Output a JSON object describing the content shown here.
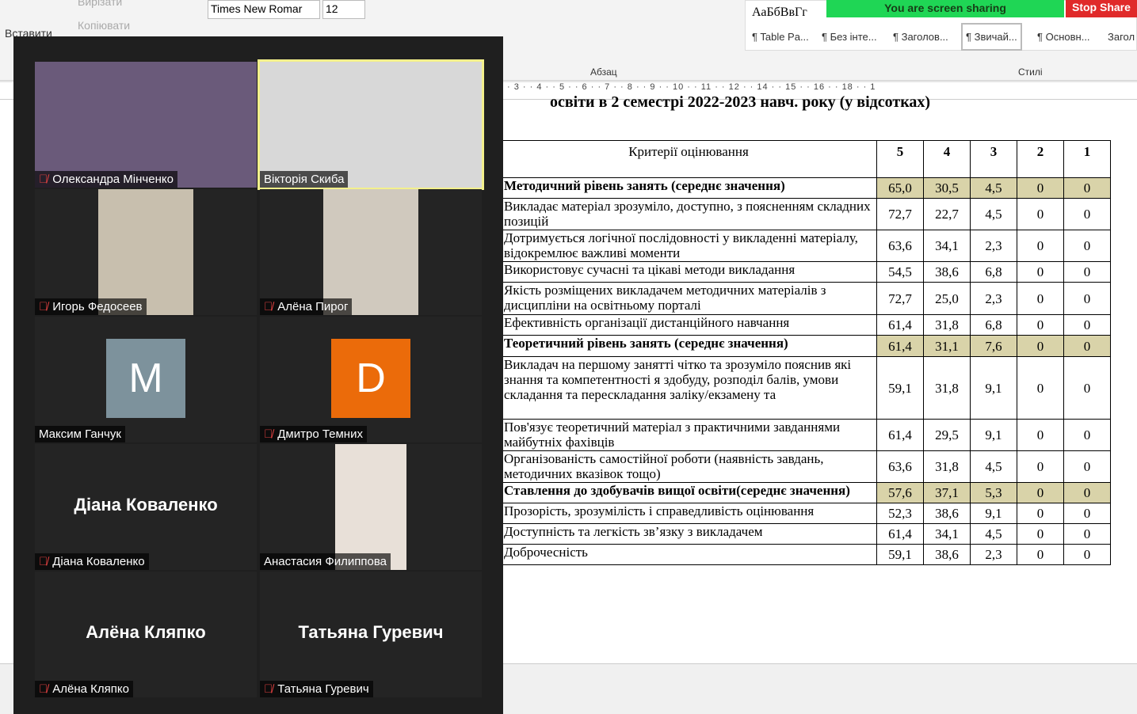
{
  "ribbon": {
    "paste": "Вставити",
    "cut": "Вирізати",
    "copy": "Копіювати",
    "font": "Times New Romar",
    "size": "12",
    "paragraph": "Абзац",
    "styles_label": "Стилі",
    "style_preview": "АаБбВвГг",
    "styles": [
      "¶ Table Pa...",
      "¶ Без інте...",
      "¶ Заголов...",
      "¶ Звичай...",
      "¶ Основн...",
      "Загол"
    ]
  },
  "ruler": "· 3 · · 4 · · 5 · · 6 · · 7 · · 8 · · 9 · · 10 · · 11 · · 12 · · 14 · · 15 · · 16 · · 18 · · 1",
  "sharing": {
    "text": "You are screen sharing",
    "stop": "Stop Share",
    "accent": "#1fd655"
  },
  "doc": {
    "title": "освіти в 2 семестрі 2022-2023 навч. року (у відсотках)",
    "headers": [
      "Критерії оцінювання",
      "5",
      "4",
      "3",
      "2",
      "1"
    ],
    "rows": [
      {
        "t": "Методичний рівень занять (середнє значення)",
        "v": [
          "65,0",
          "30,5",
          "4,5",
          "0",
          "0"
        ],
        "b": true
      },
      {
        "t": "Викладає матеріал зрозуміло, доступно, з поясненням складних позицій",
        "v": [
          "72,7",
          "22,7",
          "4,5",
          "0",
          "0"
        ]
      },
      {
        "t": "Дотримується логічної послідовності у викладенні матеріалу, відокремлює важливі моменти",
        "v": [
          "63,6",
          "34,1",
          "2,3",
          "0",
          "0"
        ]
      },
      {
        "t": "Використовує сучасні та цікаві методи викладання",
        "v": [
          "54,5",
          "38,6",
          "6,8",
          "0",
          "0"
        ]
      },
      {
        "t": "Якість розміщених викладачем методичних матеріалів з дисципліни на освітньому порталі",
        "v": [
          "72,7",
          "25,0",
          "2,3",
          "0",
          "0"
        ]
      },
      {
        "t": "Ефективність організації дистанційного навчання",
        "v": [
          "61,4",
          "31,8",
          "6,8",
          "0",
          "0"
        ]
      },
      {
        "t": "Теоретичний рівень занять (середнє значення)",
        "v": [
          "61,4",
          "31,1",
          "7,6",
          "0",
          "0"
        ],
        "b": true
      },
      {
        "t": "Викладач на першому занятті чітко та зрозуміло пояснив які знання та компетентності я здобуду, розподіл балів, умови складання та перескладання заліку/екзамену та",
        "v": [
          "59,1",
          "31,8",
          "9,1",
          "0",
          "0"
        ]
      },
      {
        "t": "Пов'язує теоретичний матеріал з практичними завданнями майбутніх фахівців",
        "v": [
          "61,4",
          "29,5",
          "9,1",
          "0",
          "0"
        ]
      },
      {
        "t": "Організованість самостійної роботи (наявність завдань, методичних вказівок тощо)",
        "v": [
          "63,6",
          "31,8",
          "4,5",
          "0",
          "0"
        ]
      },
      {
        "t": "Ставлення до здобувачів вищої освіти(середнє значення)",
        "v": [
          "57,6",
          "37,1",
          "5,3",
          "0",
          "0"
        ],
        "b": true
      },
      {
        "t": "Прозорість, зрозумілість і справедливість оцінювання",
        "v": [
          "52,3",
          "38,6",
          "9,1",
          "0",
          "0"
        ]
      },
      {
        "t": "Доступність та легкість зв’язку з викладачем",
        "v": [
          "61,4",
          "34,1",
          "4,5",
          "0",
          "0"
        ]
      },
      {
        "t": "Доброчесність",
        "v": [
          "59,1",
          "38,6",
          "2,3",
          "0",
          "0"
        ]
      }
    ]
  },
  "participants": [
    {
      "name": "Олександра Мінченко",
      "muted": true,
      "video": true
    },
    {
      "name": "Вікторія Скиба",
      "muted": false,
      "video": true,
      "active": true
    },
    {
      "name": "Игорь Федосеев",
      "muted": true,
      "video": true
    },
    {
      "name": "Алёна Пирог",
      "muted": true,
      "video": true
    },
    {
      "name": "Максим Ганчук",
      "muted": false,
      "avatar": "M",
      "avatar_color": "#7d929c"
    },
    {
      "name": "Дмитро Темних",
      "muted": true,
      "avatar": "D",
      "avatar_color": "#eb6b0a"
    },
    {
      "name": "Діана Коваленко",
      "muted": true,
      "big": "Діана Коваленко"
    },
    {
      "name": "Анастасия Филиппова",
      "muted": false,
      "video": true
    },
    {
      "name": "Алёна Кляпко",
      "muted": true,
      "big": "Алёна Кляпко"
    },
    {
      "name": "Татьяна Гуревич",
      "muted": true,
      "big": "Татьяна Гуревич"
    }
  ]
}
